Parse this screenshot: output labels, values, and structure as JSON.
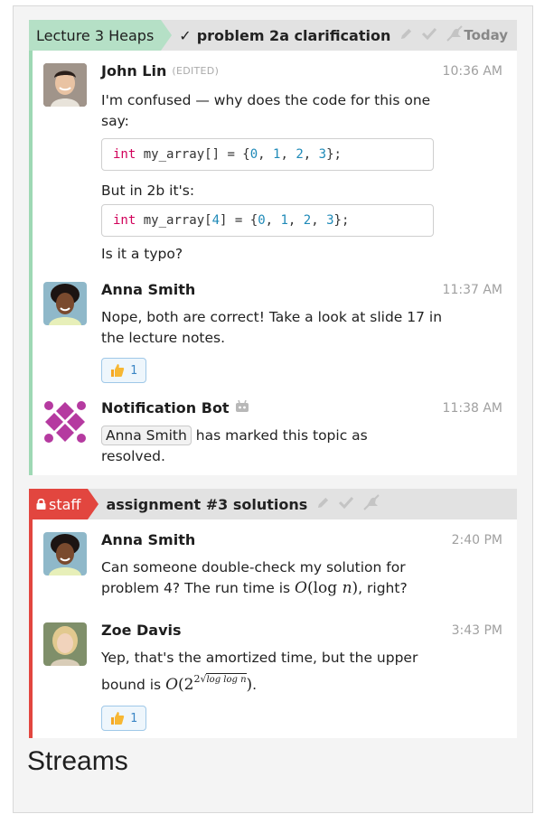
{
  "colors": {
    "stream1": "#b5e0c6",
    "stream1_stripe": "#9ed8b4",
    "stream2": "#e2463f",
    "reaction_border": "#9fc8e8"
  },
  "recipient1": {
    "stream": "Lecture 3 Heaps",
    "topic_check": "✓",
    "topic": "problem 2a clarification",
    "icons": [
      "pencil-icon",
      "check-icon",
      "mute-icon"
    ],
    "date": "Today"
  },
  "messages1": [
    {
      "sender": "John Lin",
      "edited": "(EDITED)",
      "time": "10:36 AM",
      "text1": "I'm confused — why does the code for this one say:",
      "code1": [
        "int",
        " my_array[] = {",
        "0",
        ", ",
        "1",
        ", ",
        "2",
        ", ",
        "3",
        "};"
      ],
      "text2": "But in 2b it's:",
      "code2": [
        "int",
        " my_array[",
        "4",
        "] = {",
        "0",
        ", ",
        "1",
        ", ",
        "2",
        ", ",
        "3",
        "};"
      ],
      "text3": "Is it a typo?"
    },
    {
      "sender": "Anna Smith",
      "time": "11:37 AM",
      "text": "Nope, both are correct! Take a look at slide 17 in the lecture notes.",
      "reaction_count": "1"
    },
    {
      "sender": "Notification Bot",
      "time": "11:38 AM",
      "mention": "Anna Smith",
      "text": "has marked this topic as resolved."
    }
  ],
  "recipient2": {
    "stream": "staff",
    "topic": "assignment #3 solutions",
    "icons": [
      "pencil-icon",
      "check-icon",
      "mute-icon"
    ]
  },
  "messages2": [
    {
      "sender": "Anna Smith",
      "time": "2:40 PM",
      "text_a": "Can someone double-check my solution for problem 4? The run time is",
      "math": "O(log n)",
      "text_b": ", right?"
    },
    {
      "sender": "Zoe Davis",
      "time": "3:43 PM",
      "text_a": "Yep, that's the amortized time, but the upper bound is",
      "math": "O(2^(2^√(log log n)))",
      "text_b": ".",
      "reaction_count": "1"
    }
  ],
  "footer": {
    "heading": "Streams"
  }
}
